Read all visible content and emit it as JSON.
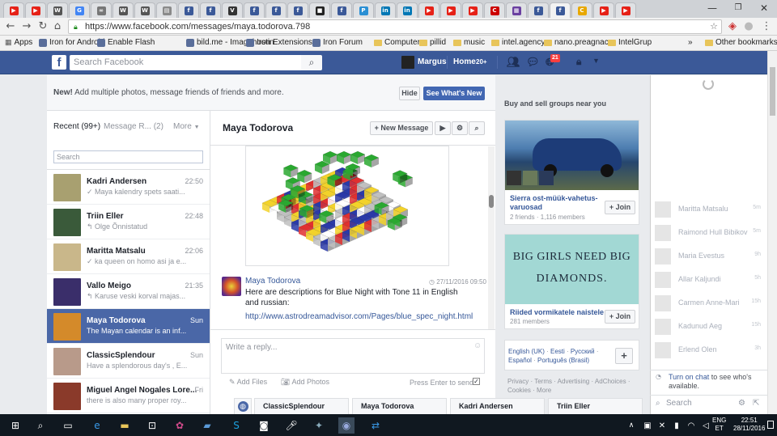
{
  "browser": {
    "tabs": [
      {
        "icon": "youtube-icon",
        "color": "#e62117",
        "glyph": "▶"
      },
      {
        "icon": "youtube-icon",
        "color": "#e62117",
        "glyph": "▶"
      },
      {
        "icon": "wikipedia-icon",
        "color": "#555555",
        "glyph": "W"
      },
      {
        "icon": "google-icon",
        "color": "#4285f4",
        "glyph": "G"
      },
      {
        "icon": "link-icon",
        "color": "#777777",
        "glyph": "∞"
      },
      {
        "icon": "wikipedia-icon",
        "color": "#555555",
        "glyph": "W"
      },
      {
        "icon": "wikipedia-icon",
        "color": "#555555",
        "glyph": "W"
      },
      {
        "icon": "document-icon",
        "color": "#8a8a8a",
        "glyph": "▤"
      },
      {
        "icon": "facebook-icon",
        "color": "#3b5998",
        "glyph": "f"
      },
      {
        "icon": "facebook-icon",
        "color": "#3b5998",
        "glyph": "f"
      },
      {
        "icon": "vimeo-icon",
        "color": "#333333",
        "glyph": "V"
      },
      {
        "icon": "facebook-icon",
        "color": "#3b5998",
        "glyph": "f"
      },
      {
        "icon": "facebook-icon",
        "color": "#3b5998",
        "glyph": "f"
      },
      {
        "icon": "facebook-icon",
        "color": "#3b5998",
        "glyph": "f"
      },
      {
        "icon": "media-icon",
        "color": "#222222",
        "glyph": "■"
      },
      {
        "icon": "facebook-icon",
        "color": "#3b5998",
        "glyph": "f"
      },
      {
        "icon": "pm-icon",
        "color": "#2a8fd4",
        "glyph": "P"
      },
      {
        "icon": "linkedin-icon",
        "color": "#0077b5",
        "glyph": "in"
      },
      {
        "icon": "linkedin-icon",
        "color": "#0077b5",
        "glyph": "in"
      },
      {
        "icon": "youtube-icon",
        "color": "#e62117",
        "glyph": "▶"
      },
      {
        "icon": "youtube-icon",
        "color": "#e62117",
        "glyph": "▶"
      },
      {
        "icon": "youtube-icon",
        "color": "#e62117",
        "glyph": "▶"
      },
      {
        "icon": "cnn-icon",
        "color": "#cc0000",
        "glyph": "C"
      },
      {
        "icon": "grid-icon",
        "color": "#6a3fa0",
        "glyph": "▦"
      },
      {
        "icon": "facebook-icon",
        "color": "#3b5998",
        "glyph": "f"
      },
      {
        "icon": "facebook-icon",
        "color": "#3b5998",
        "glyph": "f"
      },
      {
        "icon": "refresh-icon",
        "color": "#e8a800",
        "glyph": "C"
      },
      {
        "icon": "youtube-icon",
        "color": "#e62117",
        "glyph": "▶"
      },
      {
        "icon": "youtube-icon",
        "color": "#e62117",
        "glyph": "▶"
      }
    ],
    "url": "https://www.facebook.com/messages/maya.todorova.798",
    "bookmarks": [
      {
        "label": "Apps",
        "type": "apps"
      },
      {
        "label": "Iron for Android",
        "type": "page"
      },
      {
        "label": "Enable Flash",
        "type": "page"
      },
      {
        "label": "bild.me - Imagehostin",
        "type": "page"
      },
      {
        "label": "Iron Extensions",
        "type": "page"
      },
      {
        "label": "Iron Forum",
        "type": "page"
      },
      {
        "label": "Computer",
        "type": "folder"
      },
      {
        "label": "pillid",
        "type": "folder"
      },
      {
        "label": "music",
        "type": "folder"
      },
      {
        "label": "intel.agency",
        "type": "folder"
      },
      {
        "label": "nano.preagnacy",
        "type": "folder"
      },
      {
        "label": "IntelGrup",
        "type": "folder"
      }
    ],
    "bookmarks_more": "»",
    "other_bookmarks": "Other bookmarks"
  },
  "fb": {
    "logo": "f",
    "search_placeholder": "Search Facebook",
    "user_name": "Margus",
    "home_label": "Home",
    "home_count": "20+",
    "notif_count": "21",
    "brand_color": "#3b5998"
  },
  "banner": {
    "bold": "New!",
    "text": "Add multiple photos, message friends of friends and more.",
    "hide_label": "Hide",
    "whats_new_label": "See What's New"
  },
  "messenger": {
    "recent_label": "Recent (99+)",
    "requests_label": "Message R...",
    "requests_count": "(2)",
    "more_label": "More",
    "search_placeholder": "Search",
    "threads": [
      {
        "name": "Kadri Andersen",
        "time": "22:50",
        "preview": "✓ Maya kalendry spets saati...",
        "avatar": "#a8a070"
      },
      {
        "name": "Triin Eller",
        "time": "22:48",
        "preview": "↰ Olge Õnnistatud",
        "avatar": "#3a5a3a"
      },
      {
        "name": "Maritta Matsalu",
        "time": "22:06",
        "preview": "✓ ka queen on homo asi ja e...",
        "avatar": "#c9b78a"
      },
      {
        "name": "Vallo Meigo",
        "time": "21:35",
        "preview": "↰ Karuse veski korval majas...",
        "avatar": "#3a2e6a"
      },
      {
        "name": "Maya Todorova",
        "time": "Sun",
        "preview": "The Mayan calendar is an inf...",
        "avatar": "#d48a2a",
        "active": true
      },
      {
        "name": "ClassicSplendour",
        "time": "Sun",
        "preview": "Have a splendorous day's , E...",
        "avatar": "#b89a8a"
      },
      {
        "name": "Miguel Angel Nogales Lore...",
        "time": "Fri",
        "preview": "there is also many proper roy...",
        "avatar": "#8a3a2a"
      }
    ],
    "header_name": "Maya Todorova",
    "new_message_label": "+ New Message",
    "message": {
      "sender": "Maya Todorova",
      "timestamp": "27/11/2016 09:50",
      "text": "Here are descriptions for Blue Night with Tone 11 in English and russian:",
      "link": "http://www.astrodreamadvisor.com/Pages/blue_spec_night.html"
    },
    "reply_placeholder": "Write a reply...",
    "add_files": "Add Files",
    "add_photos": "Add Photos",
    "press_enter": "Press Enter to send"
  },
  "right": {
    "groups_title": "Buy and sell groups near you",
    "group1": {
      "name": "Sierra ost-müük-vahetus-varuosad",
      "meta": "2 friends · 1,116 members",
      "join": "+ Join"
    },
    "group2": {
      "poster_line1": "BIG GIRLS NEED BIG",
      "poster_line2": "DIAMONDS.",
      "name": "Riided vormikatele naistele",
      "meta": "281 members",
      "join": "+ Join"
    },
    "languages": [
      "English (UK)",
      "Eesti",
      "Русский",
      "Español",
      "Português (Brasil)"
    ],
    "footer": [
      "Privacy",
      "Terms",
      "Advertising",
      "AdChoices",
      "Cookies",
      "More"
    ]
  },
  "chat": {
    "contacts": [
      {
        "name": "Maritta Matsalu",
        "time": "5m"
      },
      {
        "name": "Raimond Hull Bibikov",
        "time": "5m"
      },
      {
        "name": "Maria Evestus",
        "time": "9h"
      },
      {
        "name": "Allar Kaljundi",
        "time": "5h"
      },
      {
        "name": "Carmen Anne-Mari",
        "time": "15h"
      },
      {
        "name": "Kadunud Aeg",
        "time": "15h"
      },
      {
        "name": "Erlend Olen",
        "time": "3h"
      }
    ],
    "turn_on_link": "Turn on chat",
    "turn_on_text": "to see who's available.",
    "search_placeholder": "Search"
  },
  "dock_tabs": [
    "ClassicSplendour",
    "Maya Todorova",
    "Kadri Andersen",
    "Triin Eller"
  ],
  "taskbar": {
    "lang": "ENG",
    "lang_sub": "ET",
    "time": "22:51",
    "date": "28/11/2016"
  }
}
